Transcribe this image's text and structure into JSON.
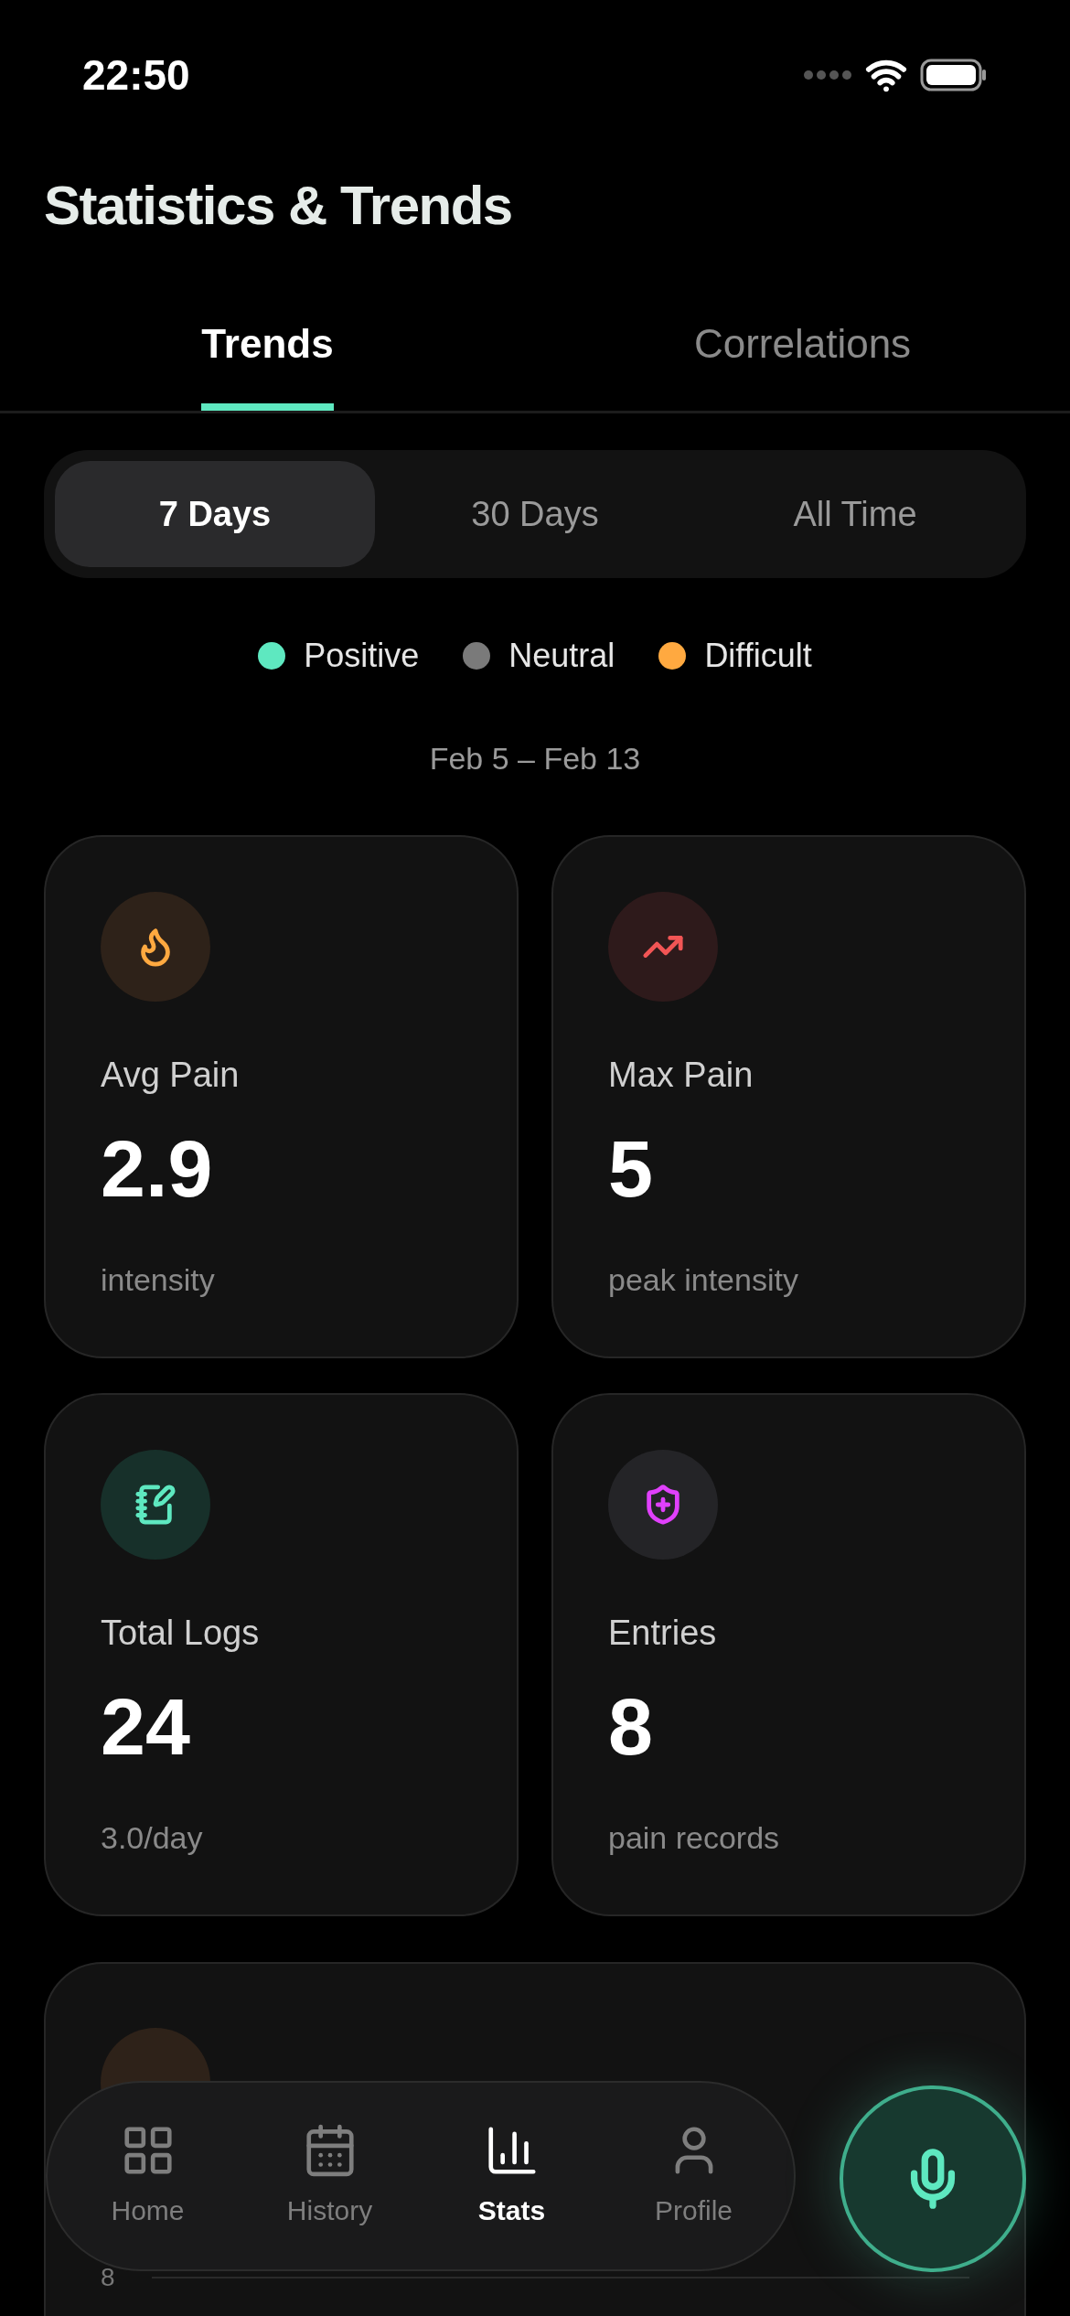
{
  "status_bar": {
    "time": "22:50"
  },
  "title": "Statistics & Trends",
  "tabs": [
    {
      "label": "Trends",
      "selected": true
    },
    {
      "label": "Correlations",
      "selected": false
    }
  ],
  "ranges": [
    {
      "label": "7 Days",
      "selected": true
    },
    {
      "label": "30 Days",
      "selected": false
    },
    {
      "label": "All Time",
      "selected": false
    }
  ],
  "legend": [
    {
      "label": "Positive",
      "color": "#5ee8c0"
    },
    {
      "label": "Neutral",
      "color": "#7a7a7a"
    },
    {
      "label": "Difficult",
      "color": "#ffa940"
    }
  ],
  "date_range": "Feb 5 – Feb 13",
  "stats": [
    {
      "kind": "flame",
      "label": "Avg Pain",
      "value": "2.9",
      "caption": "intensity"
    },
    {
      "kind": "trend",
      "label": "Max Pain",
      "value": "5",
      "caption": "peak intensity"
    },
    {
      "kind": "notes",
      "label": "Total Logs",
      "value": "24",
      "caption": "3.0/day"
    },
    {
      "kind": "shield",
      "label": "Entries",
      "value": "8",
      "caption": "pain records"
    }
  ],
  "chart_card": {
    "axis_label": "8"
  },
  "nav": [
    {
      "kind": "home",
      "label": "Home",
      "selected": false
    },
    {
      "kind": "history",
      "label": "History",
      "selected": false
    },
    {
      "kind": "stats",
      "label": "Stats",
      "selected": true
    },
    {
      "kind": "profile",
      "label": "Profile",
      "selected": false
    }
  ]
}
